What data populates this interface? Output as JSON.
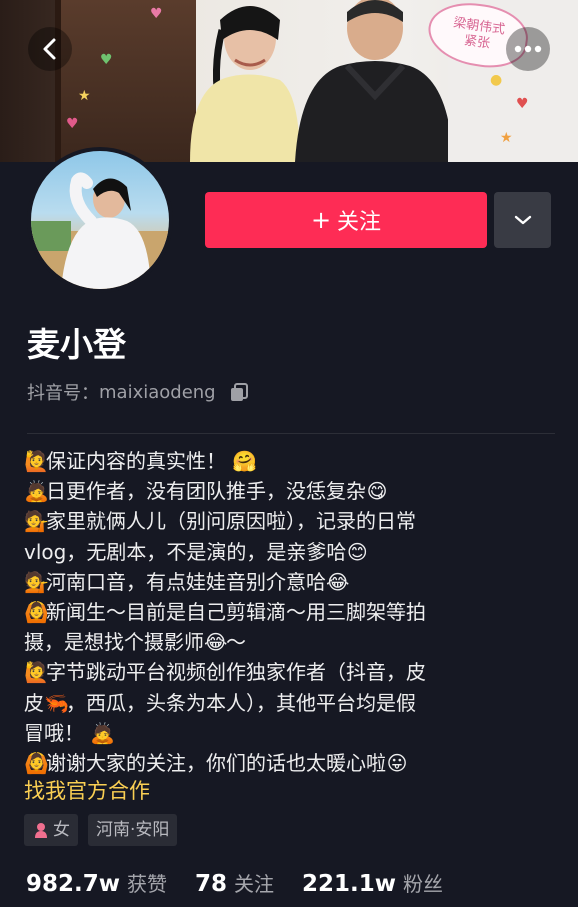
{
  "banner": {
    "bubble_text": "梁朝伟式\n紧张"
  },
  "profile": {
    "nickname": "麦小登",
    "douyin_id_label": "抖音号：",
    "douyin_id": "maixiaodeng",
    "follow_label": "关注",
    "follow_plus": "+"
  },
  "bio": {
    "lines": [
      "保证内容的真实性！",
      "日更作者，没有团队推手，没恁复杂",
      "家里就俩人儿（别问原因啦），记录的日常",
      "vlog，无剧本，不是演的，是亲爹哈",
      "河南口音，有点娃娃音别介意哈",
      "新闻生～目前是自己剪辑滴～用三脚架等拍",
      "摄，是想找个摄影师",
      "字节跳动平台视频创作独家作者（抖音，皮",
      "皮",
      "冒哦！",
      "谢谢大家的关注，你们的话也太暖心啦"
    ],
    "line8_rest": "，西瓜，头条为本人），其他平台均是假",
    "business_link": "找我官方合作"
  },
  "tags": {
    "gender": "女",
    "location": "河南·安阳"
  },
  "stats": {
    "likes_num": "982.7w",
    "likes_label": "获赞",
    "following_num": "78",
    "following_label": "关注",
    "followers_num": "221.1w",
    "followers_label": "粉丝"
  },
  "colors": {
    "accent": "#fe2c55",
    "business_link": "#facf53",
    "background": "#161823"
  },
  "icons": {
    "back": "chevron-left-icon",
    "more": "more-dots-icon",
    "dropdown": "chevron-down-icon",
    "copy": "copy-icon",
    "gender": "female-icon"
  }
}
